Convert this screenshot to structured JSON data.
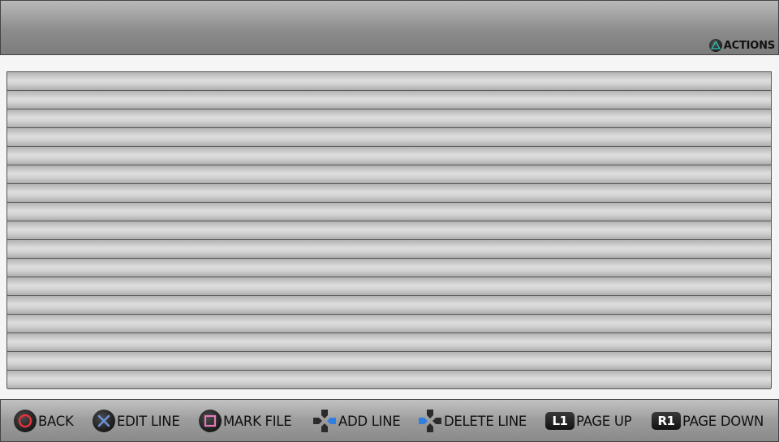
{
  "header": {
    "actions": {
      "label": "ACTIONS",
      "icon": "triangle-icon",
      "icon_color": "#2fb3a6"
    }
  },
  "list": {
    "row_count": 17,
    "rows": [
      "",
      "",
      "",
      "",
      "",
      "",
      "",
      "",
      "",
      "",
      "",
      "",
      "",
      "",
      "",
      "",
      ""
    ]
  },
  "footer": {
    "back": {
      "label": "BACK",
      "icon": "circle-icon",
      "icon_color": "#e8323c"
    },
    "edit_line": {
      "label": "EDIT LINE",
      "icon": "cross-icon",
      "icon_color": "#6d8fd6"
    },
    "mark_file": {
      "label": "MARK FILE",
      "icon": "square-icon",
      "icon_color": "#e37ab8"
    },
    "add_line": {
      "label": "ADD LINE",
      "icon": "dpad-right-icon",
      "icon_color": "#2f7fe0"
    },
    "delete_line": {
      "label": "DELETE LINE",
      "icon": "dpad-left-icon",
      "icon_color": "#2f7fe0"
    },
    "page_up": {
      "label": "PAGE UP",
      "key": "L1"
    },
    "page_down": {
      "label": "PAGE DOWN",
      "key": "R1"
    }
  }
}
